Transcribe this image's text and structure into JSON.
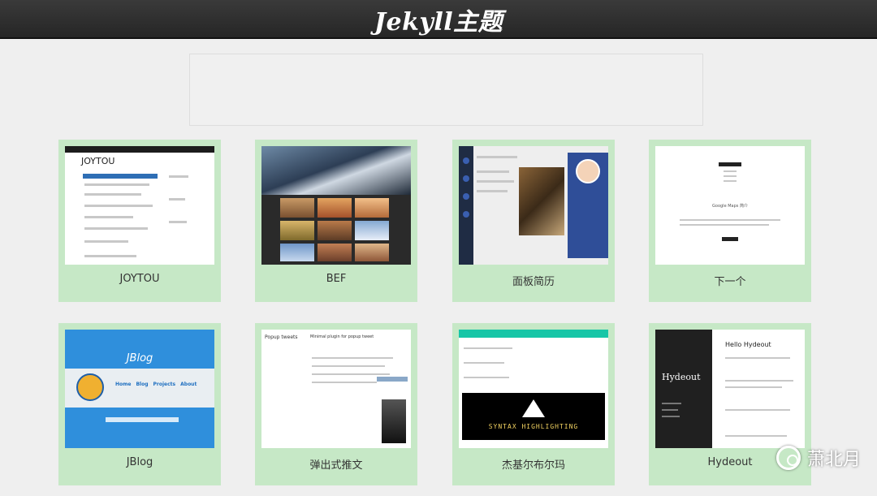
{
  "header": {
    "title": "Jekyll主题"
  },
  "themes": [
    {
      "label": "JOYTOU"
    },
    {
      "label": "BEF"
    },
    {
      "label": "面板简历"
    },
    {
      "label": "下一个"
    },
    {
      "label": "JBlog"
    },
    {
      "label": "弹出式推文"
    },
    {
      "label": "杰基尔布尔玛"
    },
    {
      "label": "Hydeout"
    }
  ],
  "thumb_text": {
    "joytou_title": "JOYTOU",
    "jblog_title": "JBlog",
    "jblog_nav": [
      "Home",
      "Blog",
      "Projects",
      "About"
    ],
    "popup_left": "Popup tweets",
    "popup_right": "Minimal plugin for popup tweet",
    "syntax": "SYNTAX HIGHLIGHTING",
    "hydeout_logo": "Hydeout",
    "hydeout_heading": "Hello Hydeout",
    "next_name": "Google Maps 简介"
  },
  "watermark": {
    "text": "萧北月"
  },
  "colors": {
    "header_bg": "#2e2e2e",
    "card_bg": "#c6e8c6",
    "page_bg": "#efefef"
  }
}
